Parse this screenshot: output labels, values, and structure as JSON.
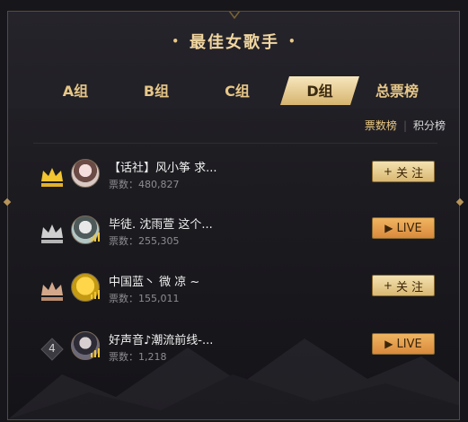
{
  "header": {
    "title": "最佳女歌手",
    "dot_left": "•",
    "dot_right": "•"
  },
  "tabs": [
    {
      "label": "A组",
      "active": false
    },
    {
      "label": "B组",
      "active": false
    },
    {
      "label": "C组",
      "active": false
    },
    {
      "label": "D组",
      "active": true
    },
    {
      "label": "总票榜",
      "active": false
    }
  ],
  "sort": {
    "active_label": "票数榜",
    "inactive_label": "积分榜",
    "separator": "|"
  },
  "rows": [
    {
      "rank_icon": "gold-crown-icon",
      "name": "【话社】风小筝 求...",
      "votes_label": "票数：480,827",
      "action": {
        "label": "关 注",
        "icon": "+",
        "kind": "follow"
      }
    },
    {
      "rank_icon": "silver-crown-icon",
      "name": "毕徒. 沈雨萱 这个...",
      "votes_label": "票数：255,305",
      "action": {
        "label": "LIVE",
        "icon": "▶",
        "kind": "live"
      }
    },
    {
      "rank_icon": "bronze-crown-icon",
      "name": "中国蓝丶 微 凉 ~",
      "votes_label": "票数：155,011",
      "action": {
        "label": "关 注",
        "icon": "+",
        "kind": "follow"
      }
    },
    {
      "rank_number": "4",
      "name": "好声音♪潮流前线-...",
      "votes_label": "票数：1,218",
      "action": {
        "label": "LIVE",
        "icon": "▶",
        "kind": "live"
      }
    }
  ],
  "colors": {
    "gold": "#e9c882",
    "live_button": "#e19a45",
    "follow_button": "#e8cf92"
  }
}
